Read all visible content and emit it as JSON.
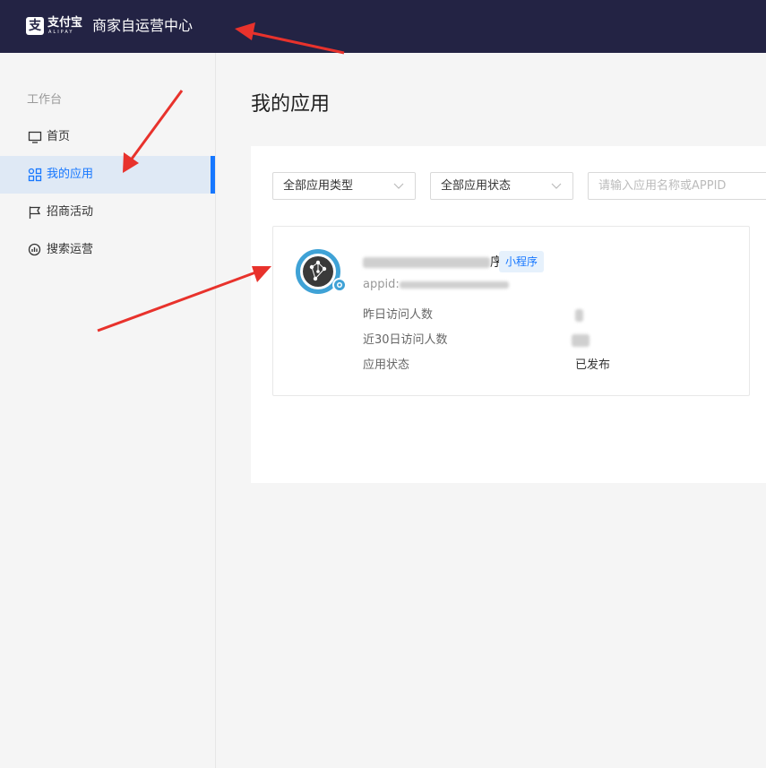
{
  "header": {
    "logo_cn": "支付宝",
    "logo_en": "ALIPAY",
    "title": "商家自运营中心",
    "bg_color": "#232344"
  },
  "sidebar": {
    "group_label": "工作台",
    "items": [
      {
        "label": "首页",
        "icon": "monitor-icon",
        "active": false
      },
      {
        "label": "我的应用",
        "icon": "apps-grid-icon",
        "active": true
      },
      {
        "label": "招商活动",
        "icon": "flag-icon",
        "active": false
      },
      {
        "label": "搜索运营",
        "icon": "search-chart-icon",
        "active": false
      }
    ],
    "active_color": "#1677ff"
  },
  "main": {
    "title": "我的应用",
    "filters": {
      "type_select": "全部应用类型",
      "status_select": "全部应用状态",
      "search_placeholder": "请输入应用名称或APPID"
    },
    "app_card": {
      "name_visible_end": "序",
      "tag": "小程序",
      "appid_label": "appid:",
      "stats": [
        {
          "label": "昨日访问人数",
          "value": ""
        },
        {
          "label": "近30日访问人数",
          "value": ""
        },
        {
          "label": "应用状态",
          "value": "已发布"
        }
      ]
    }
  },
  "annotations": {
    "arrow_color": "#e8322c"
  }
}
